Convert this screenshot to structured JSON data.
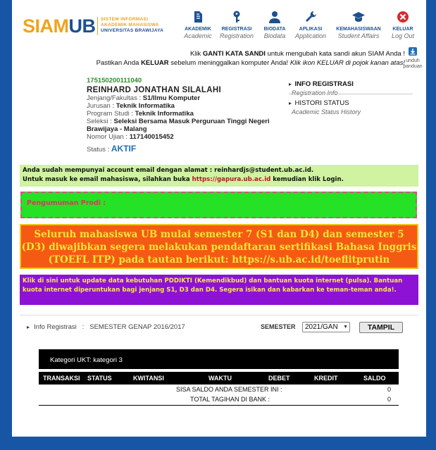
{
  "header": {
    "logo_siam": "SIAM",
    "logo_ub": "UB",
    "logo_sub": [
      "SISTEM INFORMASI",
      "AKADEMIK MAHASISWA",
      "UNIVERSITAS BRAWIJAYA"
    ],
    "nav": [
      {
        "label": "AKADEMIK",
        "sub": "Academic",
        "icon": "document-icon"
      },
      {
        "label": "REGISTRASI",
        "sub": "Registration",
        "icon": "key-icon"
      },
      {
        "label": "BIODATA",
        "sub": "Biodata",
        "icon": "person-icon"
      },
      {
        "label": "APLIKASI",
        "sub": "Application",
        "icon": "wrench-icon"
      },
      {
        "label": "KEMAHASISWAAN",
        "sub": "Student Affairs",
        "icon": "graduation-cap-icon"
      },
      {
        "label": "KELUAR",
        "sub": "Log Out",
        "icon": "close-circle-icon"
      }
    ]
  },
  "notice": {
    "line1_pre": "Klik ",
    "line1_link": "GANTI KATA SANDI",
    "line1_post": " untuk mengubah kata sandi akun SIAM Anda !",
    "line2_pre": "Pastikan Anda ",
    "line2_bold": "KELUAR",
    "line2_mid": " sebelum meninggalkan komputer Anda! ",
    "line2_italic": "Klik ikon KELUAR di pojok kanan atas!"
  },
  "unduh": {
    "line1": "unduh",
    "line2": "panduan"
  },
  "profile": {
    "nim": "175150200111040",
    "name": "REINHARD JONATHAN SILALAHI",
    "jenjang_label": "Jenjang/Fakultas",
    "jenjang_value": "S1/Ilmu Komputer",
    "jurusan_label": "Jurusan",
    "jurusan_value": "Teknik Informatika",
    "prodi_label": "Program Studi",
    "prodi_value": "Teknik Informatika",
    "seleksi_label": "Seleksi",
    "seleksi_value_1": "Seleksi Bersama Masuk Perguruan Tinggi Negeri",
    "seleksi_value_2": "Brawijaya - Malang",
    "ujian_label": "Nomor Ujian",
    "ujian_value": "117140015452",
    "status_label": "Status",
    "status_value": "AKTIF"
  },
  "side_menu": [
    {
      "title": "INFO REGISTRASI",
      "sub": "Registration Info"
    },
    {
      "title": "HISTORI STATUS",
      "sub": "Academic Status History"
    }
  ],
  "email_box": {
    "line1": "Anda sudah mempunyai account email dengan alamat : reinhardjs@student.ub.ac.id.",
    "line2_pre": "Untuk masuk ke email mahasiswa, silahkan buka ",
    "line2_link": "https://gapura.ub.ac.id",
    "line2_post": " kemudian klik Login."
  },
  "pengumuman": "Pengumuman Prodi :",
  "toefl": "Seluruh mahasiswa UB mulai semester 7 (S1 dan D4) dan semester 5 (D3) diwajibkan segera melakukan pendaftaran sertifikasi Bahasa Inggris (TOEFL ITP) pada tautan berikut: https://s.ub.ac.id/toeflitprutin",
  "pddikti": "Klik di sini untuk update data kebutuhan PDDIKTI (Kemendikbud) dan bantuan kuota internet (pulsa). Bantuan kuota internet diperuntukan bagi jenjang S1, D3 dan D4. Segera isikan dan kabarkan ke teman-teman anda!.",
  "registrasi": {
    "info_label": "Info Registrasi",
    "info_sep": ":",
    "info_value": "SEMESTER GENAP 2016/2017",
    "semester_label": "SEMESTER",
    "semester_value": "2021/GAN",
    "tampil_label": "TAMPIL"
  },
  "ukt": "Kategori UKT: kategori 3",
  "table": {
    "headers": [
      "TRANSAKSI",
      "STATUS",
      "KWITANSI",
      "WAKTU",
      "DEBET",
      "KREDIT",
      "SALDO"
    ],
    "sisa_label": "SISA SALDO ANDA SEMESTER INI :",
    "sisa_value": "0",
    "total_label": "TOTAL TAGIHAN DI BANK :",
    "total_value": "0"
  }
}
